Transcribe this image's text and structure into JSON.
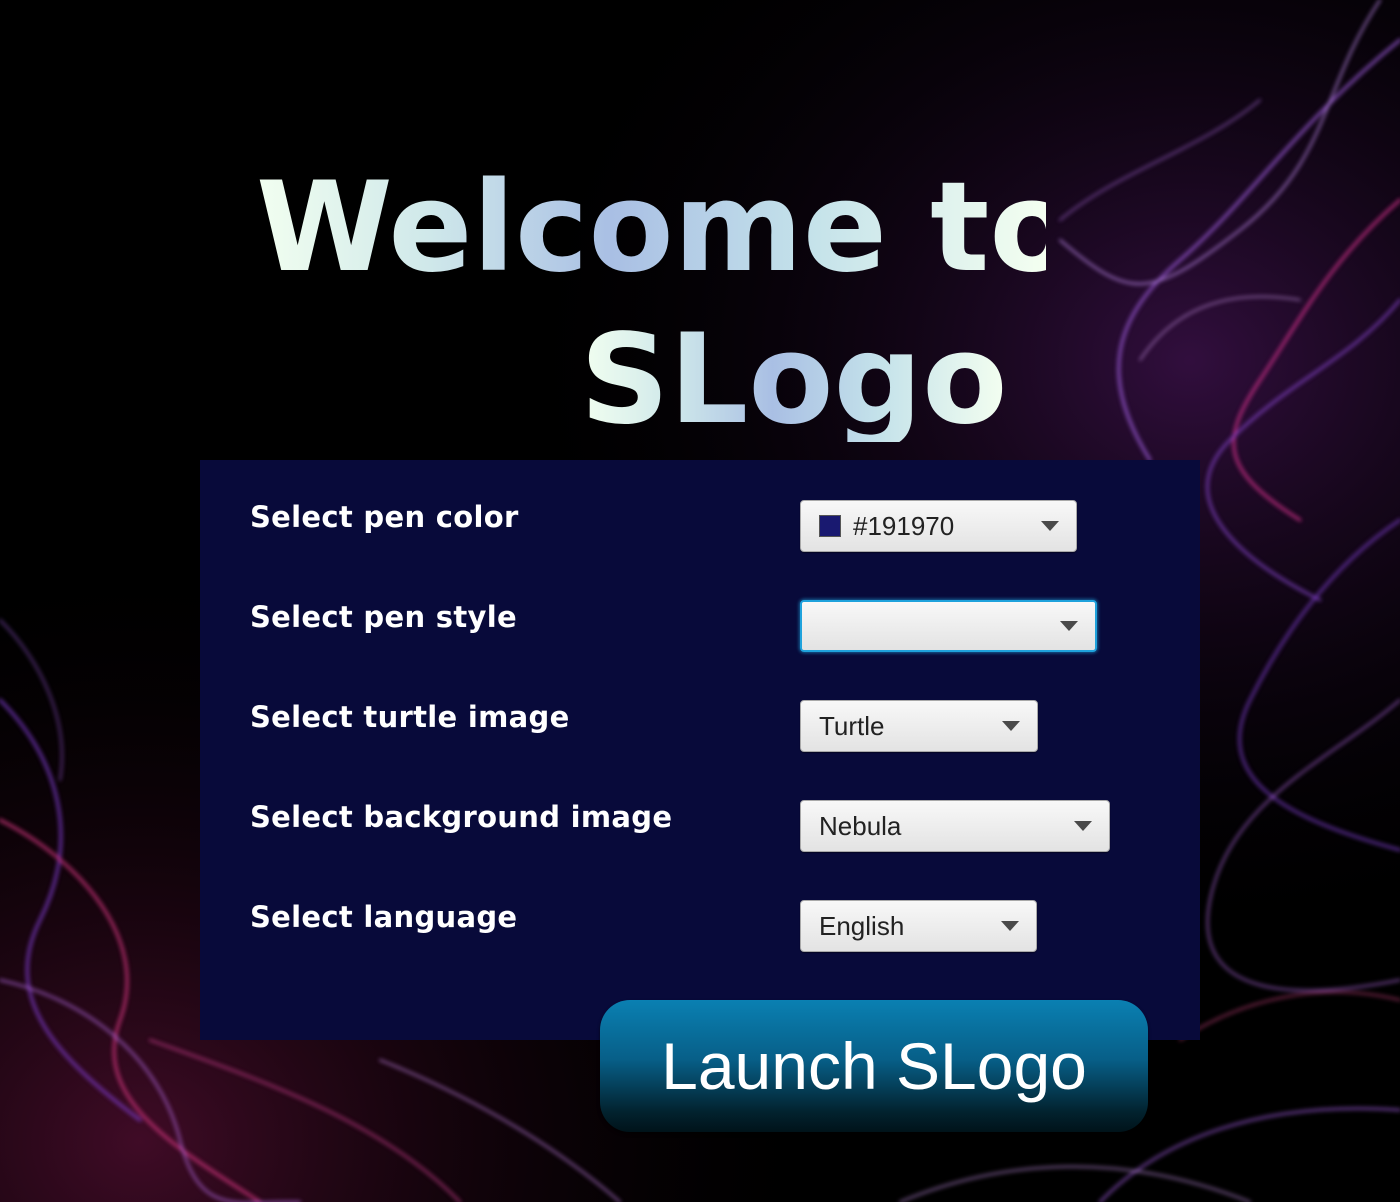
{
  "title": {
    "line1": "Welcome to",
    "line2": "SLogo"
  },
  "form": {
    "pen_color": {
      "label": "Select pen color",
      "value": "#191970",
      "swatch_color": "#191970"
    },
    "pen_style": {
      "label": "Select pen style",
      "value": ""
    },
    "turtle_image": {
      "label": "Select turtle image",
      "value": "Turtle"
    },
    "background_image": {
      "label": "Select background image",
      "value": "Nebula"
    },
    "language": {
      "label": "Select language",
      "value": "English"
    }
  },
  "launch_button": {
    "label": "Launch SLogo"
  },
  "colors": {
    "panel": "#080a3a",
    "accent_focus": "#1fa2dc",
    "button": "#0a80b2"
  }
}
